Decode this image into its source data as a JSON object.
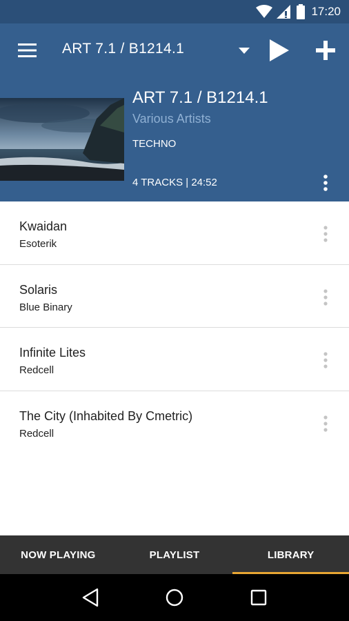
{
  "status_bar": {
    "time": "17:20",
    "icons": [
      "wifi-icon",
      "signal-icon",
      "battery-icon"
    ]
  },
  "app_bar": {
    "title": "ART 7.1 / B1214.1",
    "icons": [
      "menu-icon",
      "dropdown-icon",
      "play-icon",
      "add-icon"
    ]
  },
  "album": {
    "title": "ART 7.1 / B1214.1",
    "artist": "Various Artists",
    "genre": "TECHNO",
    "meta": "4 TRACKS | 24:52"
  },
  "tracks": [
    {
      "title": "Kwaidan",
      "artist": "Esoterik"
    },
    {
      "title": "Solaris",
      "artist": "Blue Binary"
    },
    {
      "title": "Infinite Lites",
      "artist": "Redcell"
    },
    {
      "title": "The City (Inhabited By Cmetric)",
      "artist": "Redcell"
    }
  ],
  "tabs": [
    {
      "label": "NOW PLAYING",
      "active": false
    },
    {
      "label": "PLAYLIST",
      "active": false
    },
    {
      "label": "LIBRARY",
      "active": true
    }
  ],
  "nav_bar": {
    "icons": [
      "back-icon",
      "home-icon",
      "recents-icon"
    ]
  },
  "colors": {
    "status_bar": "#2b4f78",
    "primary": "#355f8e",
    "artist_text": "#8fb0d3",
    "tab_bar": "#333333",
    "tab_indicator": "#e8a633"
  }
}
